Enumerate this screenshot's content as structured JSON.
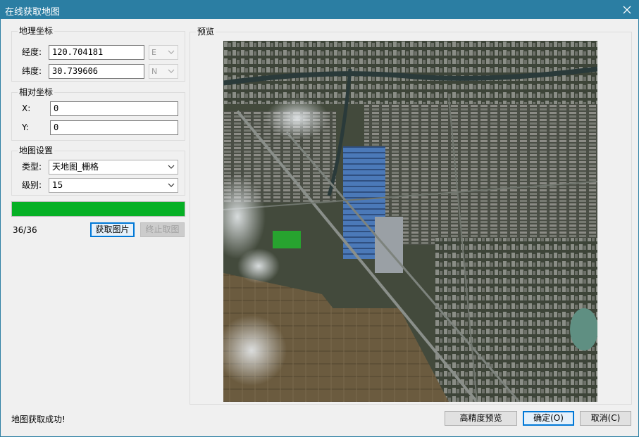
{
  "window": {
    "title": "在线获取地图"
  },
  "geo": {
    "title": "地理坐标",
    "lon_label": "经度:",
    "lon_value": "120.704181",
    "lon_dir": "E",
    "lat_label": "纬度:",
    "lat_value": "30.739606",
    "lat_dir": "N"
  },
  "relative": {
    "title": "相对坐标",
    "x_label": "X:",
    "x_value": "0",
    "y_label": "Y:",
    "y_value": "0"
  },
  "map_settings": {
    "title": "地图设置",
    "type_label": "类型:",
    "type_value": "天地图_栅格",
    "level_label": "级别:",
    "level_value": "15"
  },
  "progress": {
    "value": 1.0,
    "text": "36/36"
  },
  "buttons": {
    "fetch": "获取图片",
    "stop": "终止取图",
    "hd_preview": "高精度预览",
    "ok": "确定(O)",
    "cancel": "取消(C)"
  },
  "preview": {
    "title": "预览"
  },
  "status": {
    "message": "地图获取成功!"
  },
  "colors": {
    "titlebar": "#2b7ea3",
    "progress": "#06b025",
    "focus": "#0078d7"
  }
}
